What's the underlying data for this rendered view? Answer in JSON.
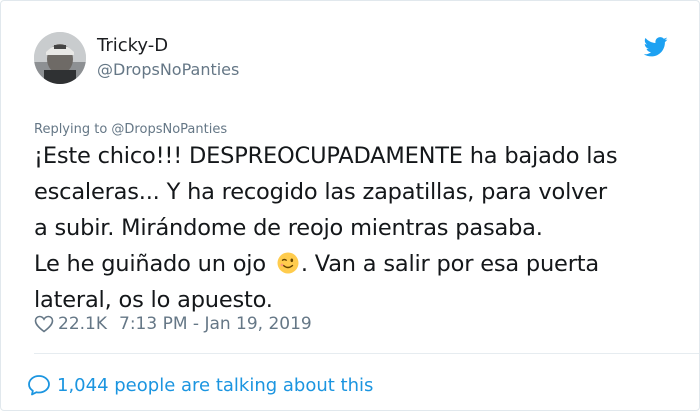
{
  "user": {
    "display_name": "Tricky-D",
    "handle": "@DropsNoPanties",
    "avatar_icon": "profile-avatar"
  },
  "reply": {
    "text": "Replying to @DropsNoPanties"
  },
  "tweet": {
    "lines": [
      "¡Este chico!!! DESPREOCUPADAMENTE ha bajado las",
      "escaleras... Y ha recogido las zapatillas, para volver",
      "a subir. Mirándome de reojo mientras pasaba.",
      "Le he guiñado un ojo",
      ".  Van a salir por esa puerta",
      "lateral, os lo apuesto."
    ],
    "emoji": "winking-face"
  },
  "meta": {
    "likes": "22.1K",
    "timestamp": "7:13 PM - Jan 19, 2019"
  },
  "footer": {
    "talking_text": "1,044 people are talking about this"
  },
  "colors": {
    "twitter_blue": "#1da1f2",
    "link_blue": "#1b95e0",
    "secondary_gray": "#657786",
    "text": "#14171a"
  }
}
